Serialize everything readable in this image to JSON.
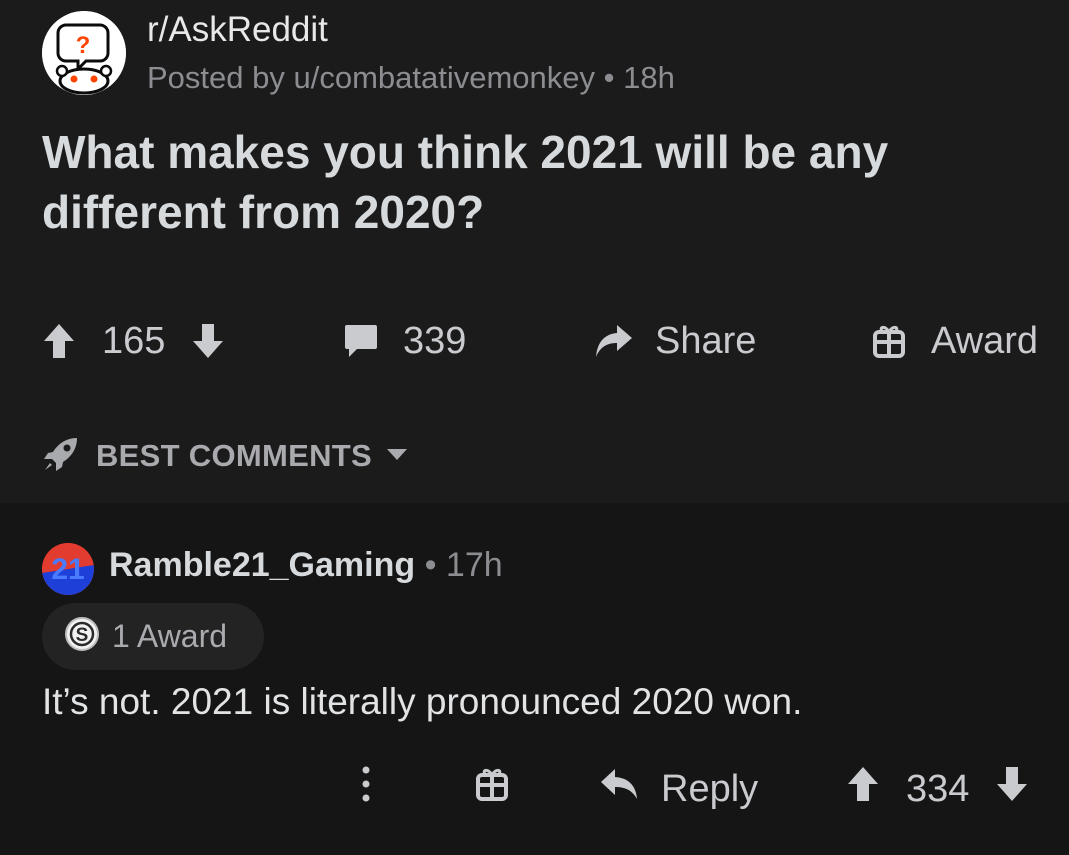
{
  "post": {
    "subreddit": "r/AskReddit",
    "posted_by": "Posted by u/combatativemonkey • 18h",
    "title": "What makes you think 2021 will be any different from 2020?",
    "votes": "165",
    "comments": "339",
    "share_label": "Share",
    "award_label": "Award"
  },
  "sort": {
    "label": "BEST COMMENTS"
  },
  "comment": {
    "avatar_text": "21",
    "author": "Ramble21_Gaming",
    "time": " • 17h",
    "award_pill": "1 Award",
    "body": "It’s not. 2021 is literally pronounced 2020 won.",
    "reply_label": "Reply",
    "votes": "334"
  },
  "colors": {
    "post_bg": "#1b1b1c",
    "comment_bg": "#151515",
    "text": "#d7dadc",
    "muted": "#8b8d90",
    "avatar_red": "#e23b2f",
    "avatar_blue": "#1e3fd8"
  },
  "icons": [
    "subreddit-avatar",
    "upvote-icon",
    "downvote-icon",
    "comment-icon",
    "share-icon",
    "gift-icon",
    "rocket-icon",
    "dropdown-icon",
    "silver-award-icon",
    "more-icon",
    "reply-icon"
  ]
}
